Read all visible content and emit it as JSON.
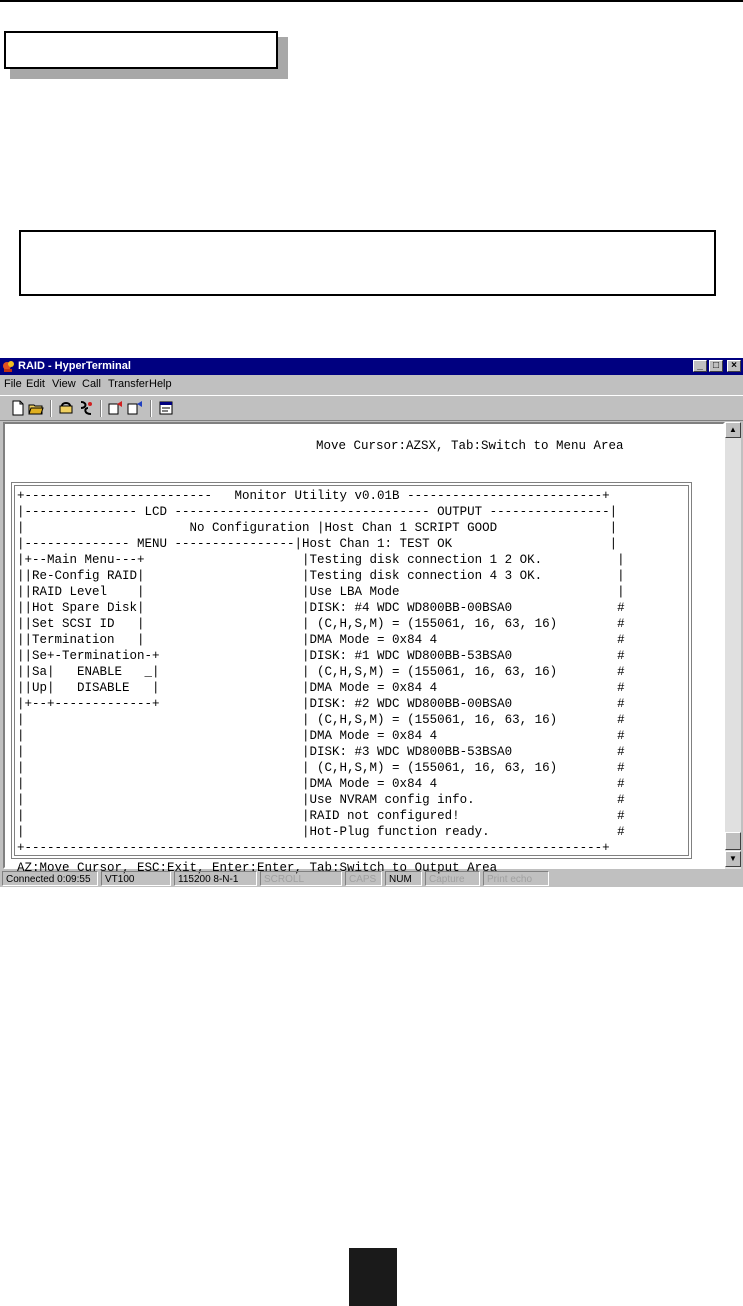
{
  "window": {
    "title": "RAID - HyperTerminal",
    "controls": [
      "_",
      "□",
      "×"
    ]
  },
  "menu": [
    "File",
    "Edit",
    "View",
    "Call",
    "Transfer",
    "Help"
  ],
  "toolbar_icons": [
    "new-icon",
    "open-icon",
    "connect-icon",
    "disconnect-icon",
    "send-icon",
    "receive-icon",
    "properties-icon"
  ],
  "terminal": {
    "hint": "Move Cursor:AZSX, Tab:Switch to Menu Area",
    "lines": [
      "+-------------------------   Monitor Utility v0.01B --------------------------+",
      "|--------------- LCD ---------------------------------- OUTPUT ----------------|",
      "|                      No Configuration |Host Chan 1 SCRIPT GOOD               |",
      "|-------------- MENU ----------------|Host Chan 1: TEST OK                     |",
      "|+--Main Menu---+                     |Testing disk connection 1 2 OK.          |",
      "||Re-Config RAID|                     |Testing disk connection 4 3 OK.          |",
      "||RAID Level    |                     |Use LBA Mode                             |",
      "||Hot Spare Disk|                     |DISK: #4 WDC WD800BB-00BSA0              #",
      "||Set SCSI ID   |                     | (C,H,S,M) = (155061, 16, 63, 16)        #",
      "||Termination   |                     |DMA Mode = 0x84 4                        #",
      "||Se+-Termination-+                   |DISK: #1 WDC WD800BB-53BSA0              #",
      "||Sa|   ENABLE   _|                   | (C,H,S,M) = (155061, 16, 63, 16)        #",
      "||Up|   DISABLE   |                   |DMA Mode = 0x84 4                        #",
      "|+--+-------------+                   |DISK: #2 WDC WD800BB-00BSA0              #",
      "|                                     | (C,H,S,M) = (155061, 16, 63, 16)        #",
      "|                                     |DMA Mode = 0x84 4                        #",
      "|                                     |DISK: #3 WDC WD800BB-53BSA0              #",
      "|                                     | (C,H,S,M) = (155061, 16, 63, 16)        #",
      "|                                     |DMA Mode = 0x84 4                        #",
      "|                                     |Use NVRAM config info.                   #",
      "|                                     |RAID not configured!                     #",
      "|                                     |Hot-Plug function ready.                 #",
      "+-----------------------------------------------------------------------------+",
      "AZ:Move Cursor, ESC:Exit, Enter:Enter, Tab:Switch to Output Area"
    ]
  },
  "status": {
    "connected": "Connected 0:09:55",
    "emulation": "VT100",
    "port": "115200 8-N-1",
    "scroll": "SCROLL",
    "caps": "CAPS",
    "num": "NUM",
    "capture": "Capture",
    "print_echo": "Print echo"
  }
}
